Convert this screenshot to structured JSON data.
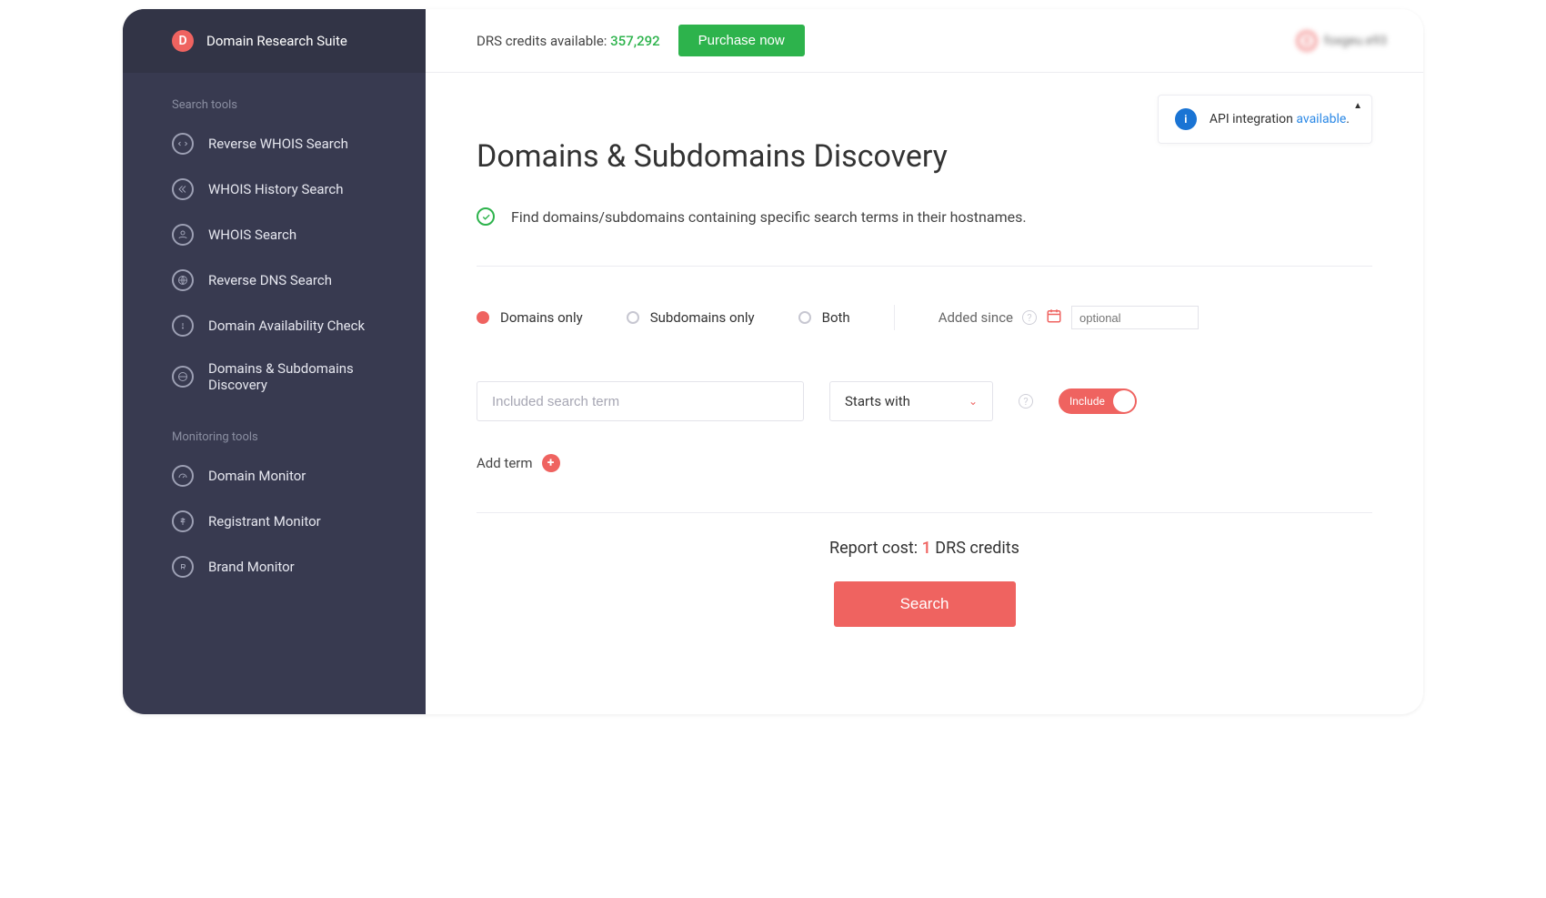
{
  "brand": {
    "title": "Domain Research Suite",
    "logo_letter": "D"
  },
  "sidebar": {
    "sections": [
      {
        "label": "Search tools",
        "items": [
          {
            "id": "reverse-whois",
            "label": "Reverse WHOIS Search",
            "icon": "swap"
          },
          {
            "id": "whois-history",
            "label": "WHOIS History Search",
            "icon": "rewind"
          },
          {
            "id": "whois-search",
            "label": "WHOIS Search",
            "icon": "person"
          },
          {
            "id": "reverse-dns",
            "label": "Reverse DNS Search",
            "icon": "globe"
          },
          {
            "id": "domain-availability",
            "label": "Domain Availability Check",
            "icon": "alert"
          },
          {
            "id": "domains-subdomains",
            "label": "Domains & Subdomains Discovery",
            "icon": "world"
          }
        ]
      },
      {
        "label": "Monitoring tools",
        "items": [
          {
            "id": "domain-monitor",
            "label": "Domain Monitor",
            "icon": "gauge"
          },
          {
            "id": "registrant-monitor",
            "label": "Registrant Monitor",
            "icon": "dollar"
          },
          {
            "id": "brand-monitor",
            "label": "Brand Monitor",
            "icon": "registered"
          }
        ]
      }
    ]
  },
  "topbar": {
    "credits_label": "DRS credits available: ",
    "credits_value": "357,292",
    "purchase_label": "Purchase now",
    "user_name": "foxgeu.e93"
  },
  "api_banner": {
    "text_prefix": "API integration ",
    "link_text": "available",
    "icon_letter": "i"
  },
  "page": {
    "title": "Domains & Subdomains Discovery",
    "subtitle": "Find domains/subdomains containing specific search terms in their hostnames."
  },
  "filters": {
    "radios": [
      {
        "id": "domains-only",
        "label": "Domains only",
        "selected": true
      },
      {
        "id": "subdomains-only",
        "label": "Subdomains only",
        "selected": false
      },
      {
        "id": "both",
        "label": "Both",
        "selected": false
      }
    ],
    "added_since_label": "Added since",
    "date_placeholder": "optional"
  },
  "term": {
    "placeholder": "Included search term",
    "match_mode": "Starts with",
    "toggle_label": "Include"
  },
  "add_term_label": "Add term",
  "cost": {
    "prefix": "Report cost: ",
    "value": "1",
    "suffix": " DRS credits"
  },
  "search_button": "Search"
}
